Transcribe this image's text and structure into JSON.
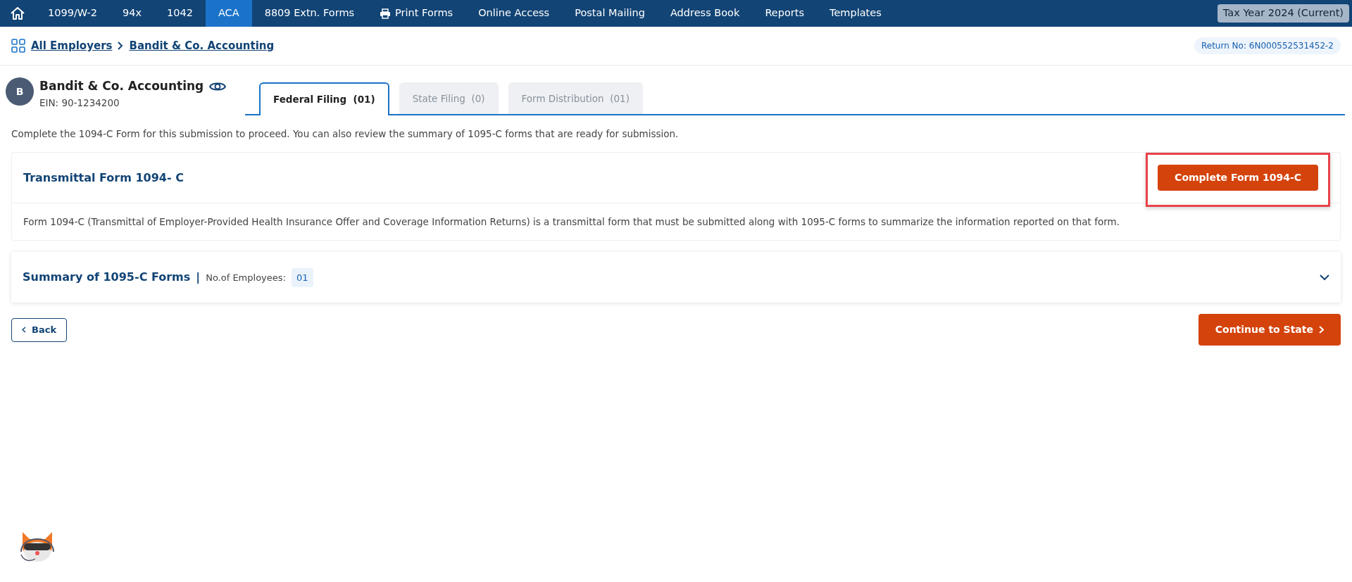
{
  "nav": {
    "items": [
      {
        "label": "1099/W-2",
        "selected": false,
        "kind": "text"
      },
      {
        "label": "94x",
        "selected": false,
        "kind": "text"
      },
      {
        "label": "1042",
        "selected": false,
        "kind": "text"
      },
      {
        "label": "ACA",
        "selected": true,
        "kind": "text"
      },
      {
        "label": "8809 Extn. Forms",
        "selected": false,
        "kind": "text"
      },
      {
        "label": "Print Forms",
        "selected": false,
        "kind": "printer"
      },
      {
        "label": "Online Access",
        "selected": false,
        "kind": "text"
      },
      {
        "label": "Postal Mailing",
        "selected": false,
        "kind": "text"
      },
      {
        "label": "Address Book",
        "selected": false,
        "kind": "text"
      },
      {
        "label": "Reports",
        "selected": false,
        "kind": "text"
      },
      {
        "label": "Templates",
        "selected": false,
        "kind": "text"
      }
    ],
    "tax_year": "Tax Year 2024 (Current)"
  },
  "breadcrumb": [
    "All Employers",
    "Bandit & Co. Accounting"
  ],
  "return_no": {
    "label": "Return No:",
    "value": "6N000552531452-2"
  },
  "employer": {
    "initial": "B",
    "name": "Bandit & Co. Accounting",
    "ein": "EIN: 90-1234200"
  },
  "tabs": [
    {
      "label": "Federal Filing",
      "count": "(01)",
      "selected": true
    },
    {
      "label": "State Filing",
      "count": "(0)",
      "selected": false
    },
    {
      "label": "Form Distribution",
      "count": "(01)",
      "selected": false
    }
  ],
  "intro": "Complete the 1094-C Form for this submission to proceed. You can also review the summary of 1095-C forms that are ready for submission.",
  "transmittal": {
    "title": "Transmittal Form 1094- C",
    "button": "Complete Form 1094-C",
    "highlighted": true,
    "description": "Form 1094-C (Transmittal of Employer-Provided Health Insurance Offer and Coverage Information Returns) is a transmittal form that must be submitted along with 1095-C forms to summarize the information reported on that form."
  },
  "summary": {
    "title": "Summary of 1095-C Forms",
    "separator": "|",
    "employees_label": "No.of Employees:",
    "employees": "01",
    "expanded": false
  },
  "footer": {
    "back": "Back",
    "continue": "Continue to State"
  }
}
